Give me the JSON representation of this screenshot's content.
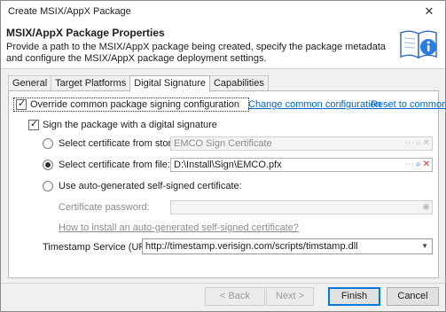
{
  "window": {
    "title": "Create MSIX/AppX Package",
    "close_glyph": "✕"
  },
  "header": {
    "title": "MSIX/AppX Package Properties",
    "description": "Provide a path to the MSIX/AppX package being created, specify the package metadata and configure the MSIX/AppX package deployment settings.",
    "icon": "book-info-icon"
  },
  "tabs": [
    {
      "label": "General",
      "active": false
    },
    {
      "label": "Target Platforms",
      "active": false
    },
    {
      "label": "Digital Signature",
      "active": true
    },
    {
      "label": "Capabilities",
      "active": false
    }
  ],
  "signature": {
    "override_label": "Override common package signing configuration",
    "override_checked": true,
    "change_link": "Change common configuration",
    "reset_link": "Reset to common",
    "sign_label": "Sign the package with a digital signature",
    "sign_checked": true,
    "from_store_label": "Select certificate from store:",
    "from_store_value": "EMCO Sign Certificate",
    "from_file_label": "Select certificate from file:",
    "from_file_value": "D:\\Install\\Sign\\EMCO.pfx",
    "auto_label": "Use auto-generated self-signed certificate:",
    "password_label": "Certificate password:",
    "password_value": "",
    "how_to_link": "How to install an auto-generated self-signed certificate?",
    "timestamp_label": "Timestamp Service (URL):",
    "timestamp_value": "http://timestamp.verisign.com/scripts/timstamp.dll",
    "selected_source": "file"
  },
  "buttons": {
    "back": "< Back",
    "next": "Next >",
    "finish": "Finish",
    "cancel": "Cancel"
  },
  "colors": {
    "link": "#0066cc",
    "accent": "#0078d7",
    "clear_red": "#d93025"
  }
}
